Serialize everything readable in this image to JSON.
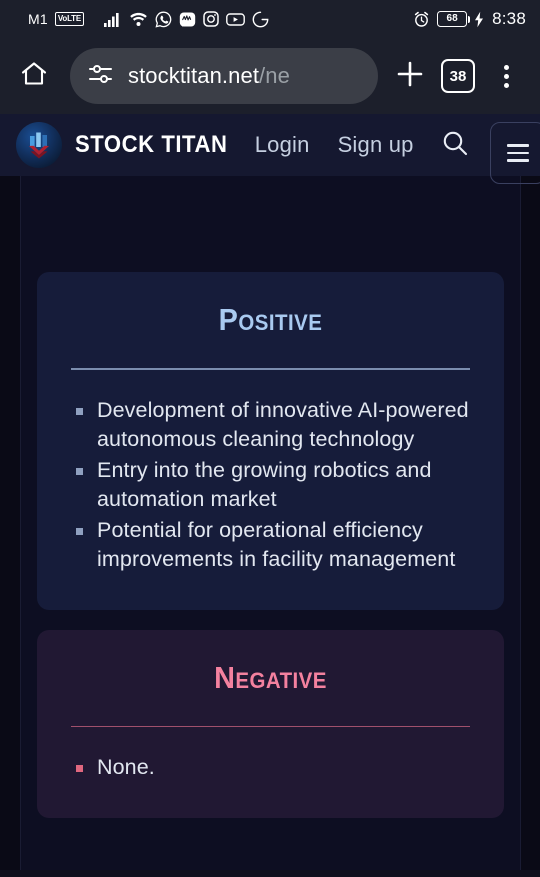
{
  "status_bar": {
    "carrier": "M1",
    "volte_badge": "VoLTE",
    "icons": [
      "signal-bars-icon",
      "wifi-icon",
      "whatsapp-icon",
      "messaging-icon",
      "instagram-icon",
      "youtube-icon",
      "grammarly-icon"
    ],
    "alarm_icon": "alarm-clock-icon",
    "battery_level": "68",
    "charging_icon": "charging-bolt-icon",
    "time": "8:38"
  },
  "browser": {
    "home_icon": "home-icon",
    "site_settings_icon": "tune-sliders-icon",
    "url_domain": "stocktitan.net",
    "url_path": "/ne",
    "new_tab_icon": "plus-icon",
    "tab_count": "38",
    "menu_icon": "three-dot-menu-icon"
  },
  "site_header": {
    "logo_icon": "stock-titan-logo-icon",
    "brand": "STOCK TITAN",
    "login_label": "Login",
    "signup_label": "Sign up",
    "search_icon": "search-icon",
    "menu_icon": "hamburger-menu-icon"
  },
  "main": {
    "positive": {
      "title": "Positive",
      "bullets": [
        "Development of innovative AI-powered autonomous cleaning technology",
        "Entry into the growing robotics and automation market",
        "Potential for operational efficiency improvements in facility management"
      ]
    },
    "negative": {
      "title": "Negative",
      "bullets": [
        "None."
      ]
    }
  },
  "colors": {
    "page_bg": "#0d0e22",
    "positive_card": "#161c3a",
    "negative_card": "#211833",
    "positive_accent": "#a9caf0",
    "negative_accent": "#f4819f",
    "header_bg": "#151830",
    "chrome_bg": "#1c1f2b"
  }
}
